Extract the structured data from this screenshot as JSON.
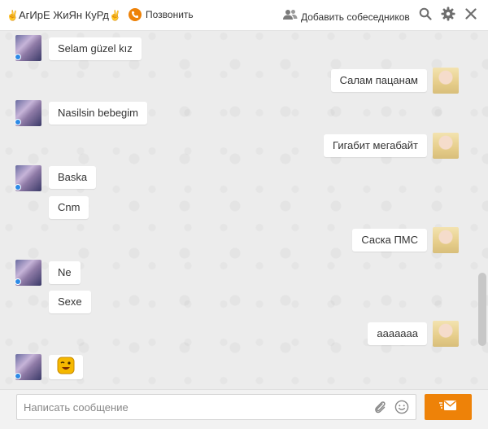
{
  "header": {
    "name": "АгИрЕ ЖиЯн КуРд",
    "hand_left": "✌",
    "hand_right": "✌",
    "call_label": "Позвонить",
    "add_label": "Добавить собеседников",
    "icons": [
      "phone-icon",
      "add-people-icon",
      "search-icon",
      "gear-icon",
      "close-icon"
    ]
  },
  "messages": [
    {
      "side": "in",
      "text": "Selam güzel kız"
    },
    {
      "side": "out",
      "text": "Салам пацанам"
    },
    {
      "side": "in",
      "text": "Nasilsin bebegim"
    },
    {
      "side": "out",
      "text": "Гигабит мегабайт"
    },
    {
      "side": "in",
      "text": "Baska"
    },
    {
      "side": "in",
      "text": "Cnm"
    },
    {
      "side": "out",
      "text": "Саска ПМС"
    },
    {
      "side": "in",
      "text": "Ne"
    },
    {
      "side": "in",
      "text": "Sexe"
    },
    {
      "side": "out",
      "text": "ааааааа"
    },
    {
      "side": "in",
      "text": "",
      "sticker": "winking-smiley-sticker"
    }
  ],
  "composer": {
    "placeholder": "Написать сообщение",
    "value": ""
  },
  "colors": {
    "accent": "#ee8208",
    "online": "#2d8ae6",
    "background": "#ececec"
  }
}
